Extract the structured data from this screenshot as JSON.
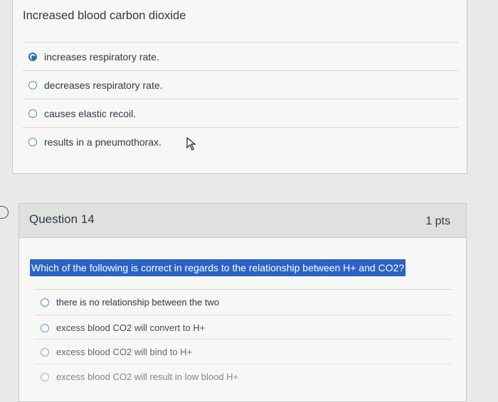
{
  "question13": {
    "text": "Increased blood carbon dioxide",
    "answers": [
      {
        "label": "increases respiratory rate.",
        "selected": true
      },
      {
        "label": "decreases respiratory rate.",
        "selected": false
      },
      {
        "label": "causes elastic recoil.",
        "selected": false
      },
      {
        "label": "results in a pneumothorax.",
        "selected": false
      }
    ]
  },
  "question14": {
    "title": "Question 14",
    "points": "1 pts",
    "text": "Which of the following is correct in regards to the relationship between H+ and CO2?",
    "answers": [
      {
        "label": "there is no relationship between the two",
        "selected": false
      },
      {
        "label": "excess blood CO2 will convert to H+",
        "selected": false
      },
      {
        "label": "excess blood CO2 will bind to H+",
        "selected": false
      },
      {
        "label": "excess blood CO2 will result in low blood H+",
        "selected": false
      }
    ]
  },
  "colors": {
    "accent": "#1d6fb8",
    "highlight": "#2a63c6",
    "text": "#2d3b45"
  }
}
